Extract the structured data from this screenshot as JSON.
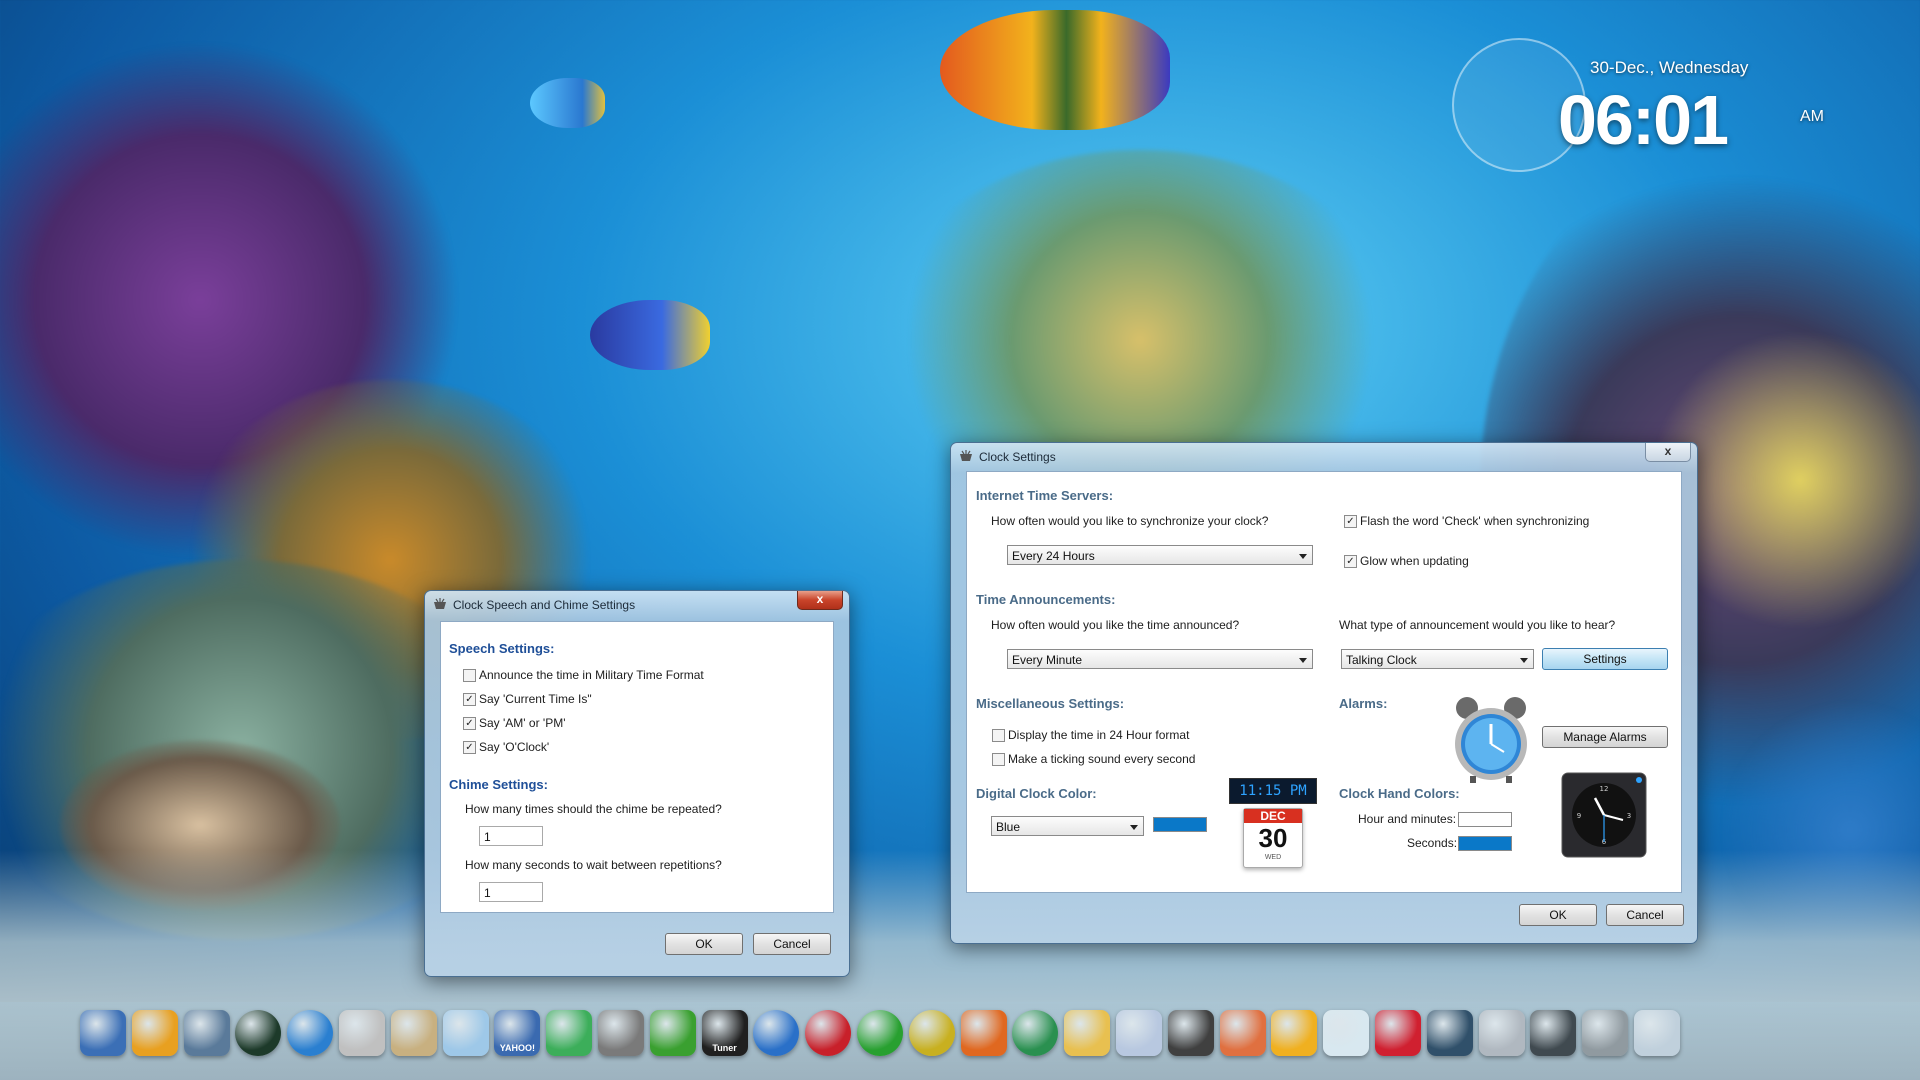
{
  "desktop_clock": {
    "date": "30-Dec., Wednesday",
    "time": "06:01",
    "ampm": "AM"
  },
  "speech_window": {
    "title": "Clock Speech and Chime Settings",
    "close_label": "x",
    "speech_header": "Speech Settings:",
    "options": [
      {
        "label": "Announce the time in Military Time Format",
        "checked": false
      },
      {
        "label": "Say 'Current Time Is\"",
        "checked": true
      },
      {
        "label": "Say 'AM' or 'PM'",
        "checked": true
      },
      {
        "label": "Say 'O'Clock'",
        "checked": true
      }
    ],
    "chime_header": "Chime Settings:",
    "repeat_question": "How many times should the chime be repeated?",
    "repeat_value": "1",
    "wait_question": "How many seconds to wait between repetitions?",
    "wait_value": "1",
    "ok_label": "OK",
    "cancel_label": "Cancel"
  },
  "clock_window": {
    "title": "Clock Settings",
    "close_label": "x",
    "servers_header": "Internet Time Servers:",
    "sync_question": "How often would you like to synchronize your clock?",
    "sync_value": "Every 24 Hours",
    "flash_label": "Flash the word 'Check' when synchronizing",
    "flash_checked": true,
    "glow_label": "Glow when updating",
    "glow_checked": true,
    "announce_header": "Time Announcements:",
    "announce_question": "How often would you like the time announced?",
    "announce_value": "Every Minute",
    "type_question": "What type of announcement would you like to hear?",
    "type_value": "Talking Clock",
    "settings_label": "Settings",
    "misc_header": "Miscellaneous Settings:",
    "hour24_label": "Display the time in 24 Hour format",
    "hour24_checked": false,
    "ticking_label": "Make a ticking sound every second",
    "ticking_checked": false,
    "alarms_header": "Alarms:",
    "manage_alarms_label": "Manage Alarms",
    "digital_header": "Digital Clock Color:",
    "digital_value": "Blue",
    "digital_color": "#0a78c8",
    "digital_preview_time": "11:15 PM",
    "calendar_month": "DEC",
    "calendar_day": "30",
    "calendar_weekday": "WED",
    "hands_header": "Clock Hand Colors:",
    "hour_minutes_label": "Hour and minutes:",
    "hour_minutes_color": "#ffffff",
    "seconds_label": "Seconds:",
    "seconds_color": "#0a78c8",
    "ok_label": "OK",
    "cancel_label": "Cancel"
  },
  "dock": {
    "icons": [
      "nexus-icon",
      "windows-flag-icon",
      "finder-icon",
      "speedometer-icon",
      "speaker-icon",
      "search-icon",
      "notes-icon",
      "folder-icon",
      "yahoo-icon",
      "download-icon",
      "gear-icon",
      "music-icon",
      "tuner-icon",
      "windows-orb-icon",
      "red-orb-icon",
      "green-orb-icon",
      "yellow-orb-icon",
      "firefox-icon",
      "chrome-icon",
      "stickies-icon",
      "microphone-icon",
      "media-icon",
      "paint-icon",
      "weather-icon",
      "itunes-icon",
      "heart-icon",
      "camera-icon",
      "disc-icon",
      "clock-icon",
      "trash-icon",
      "folder-stack-icon"
    ],
    "yahoo_label": "YAHOO!",
    "tuner_label": "Tuner"
  }
}
